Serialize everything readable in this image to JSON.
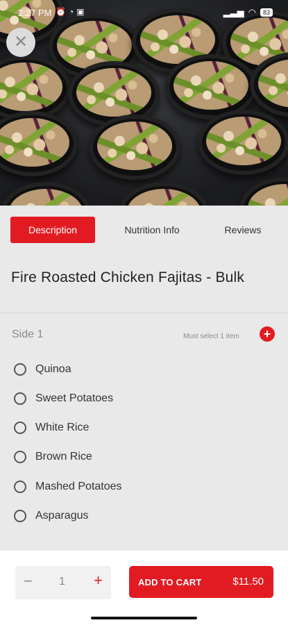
{
  "status_bar": {
    "time": "2:27 PM",
    "battery": "83"
  },
  "tabs": [
    {
      "label": "Description",
      "active": true
    },
    {
      "label": "Nutrition Info",
      "active": false
    },
    {
      "label": "Reviews",
      "active": false
    }
  ],
  "product": {
    "title": "Fire Roasted Chicken Fajitas - Bulk"
  },
  "side_group": {
    "label": "Side 1",
    "requirement": "Must select 1 item",
    "options": [
      "Quinoa",
      "Sweet Potatoes",
      "White Rice",
      "Brown Rice",
      "Mashed Potatoes",
      "Asparagus"
    ]
  },
  "cart": {
    "quantity": "1",
    "minus_symbol": "−",
    "plus_symbol": "+",
    "add_label": "ADD TO CART",
    "price": "$11.50"
  },
  "colors": {
    "accent": "#e21b23",
    "background": "#e9e9e9"
  },
  "icons": {
    "close": "close-icon",
    "add": "plus-circle-icon"
  }
}
